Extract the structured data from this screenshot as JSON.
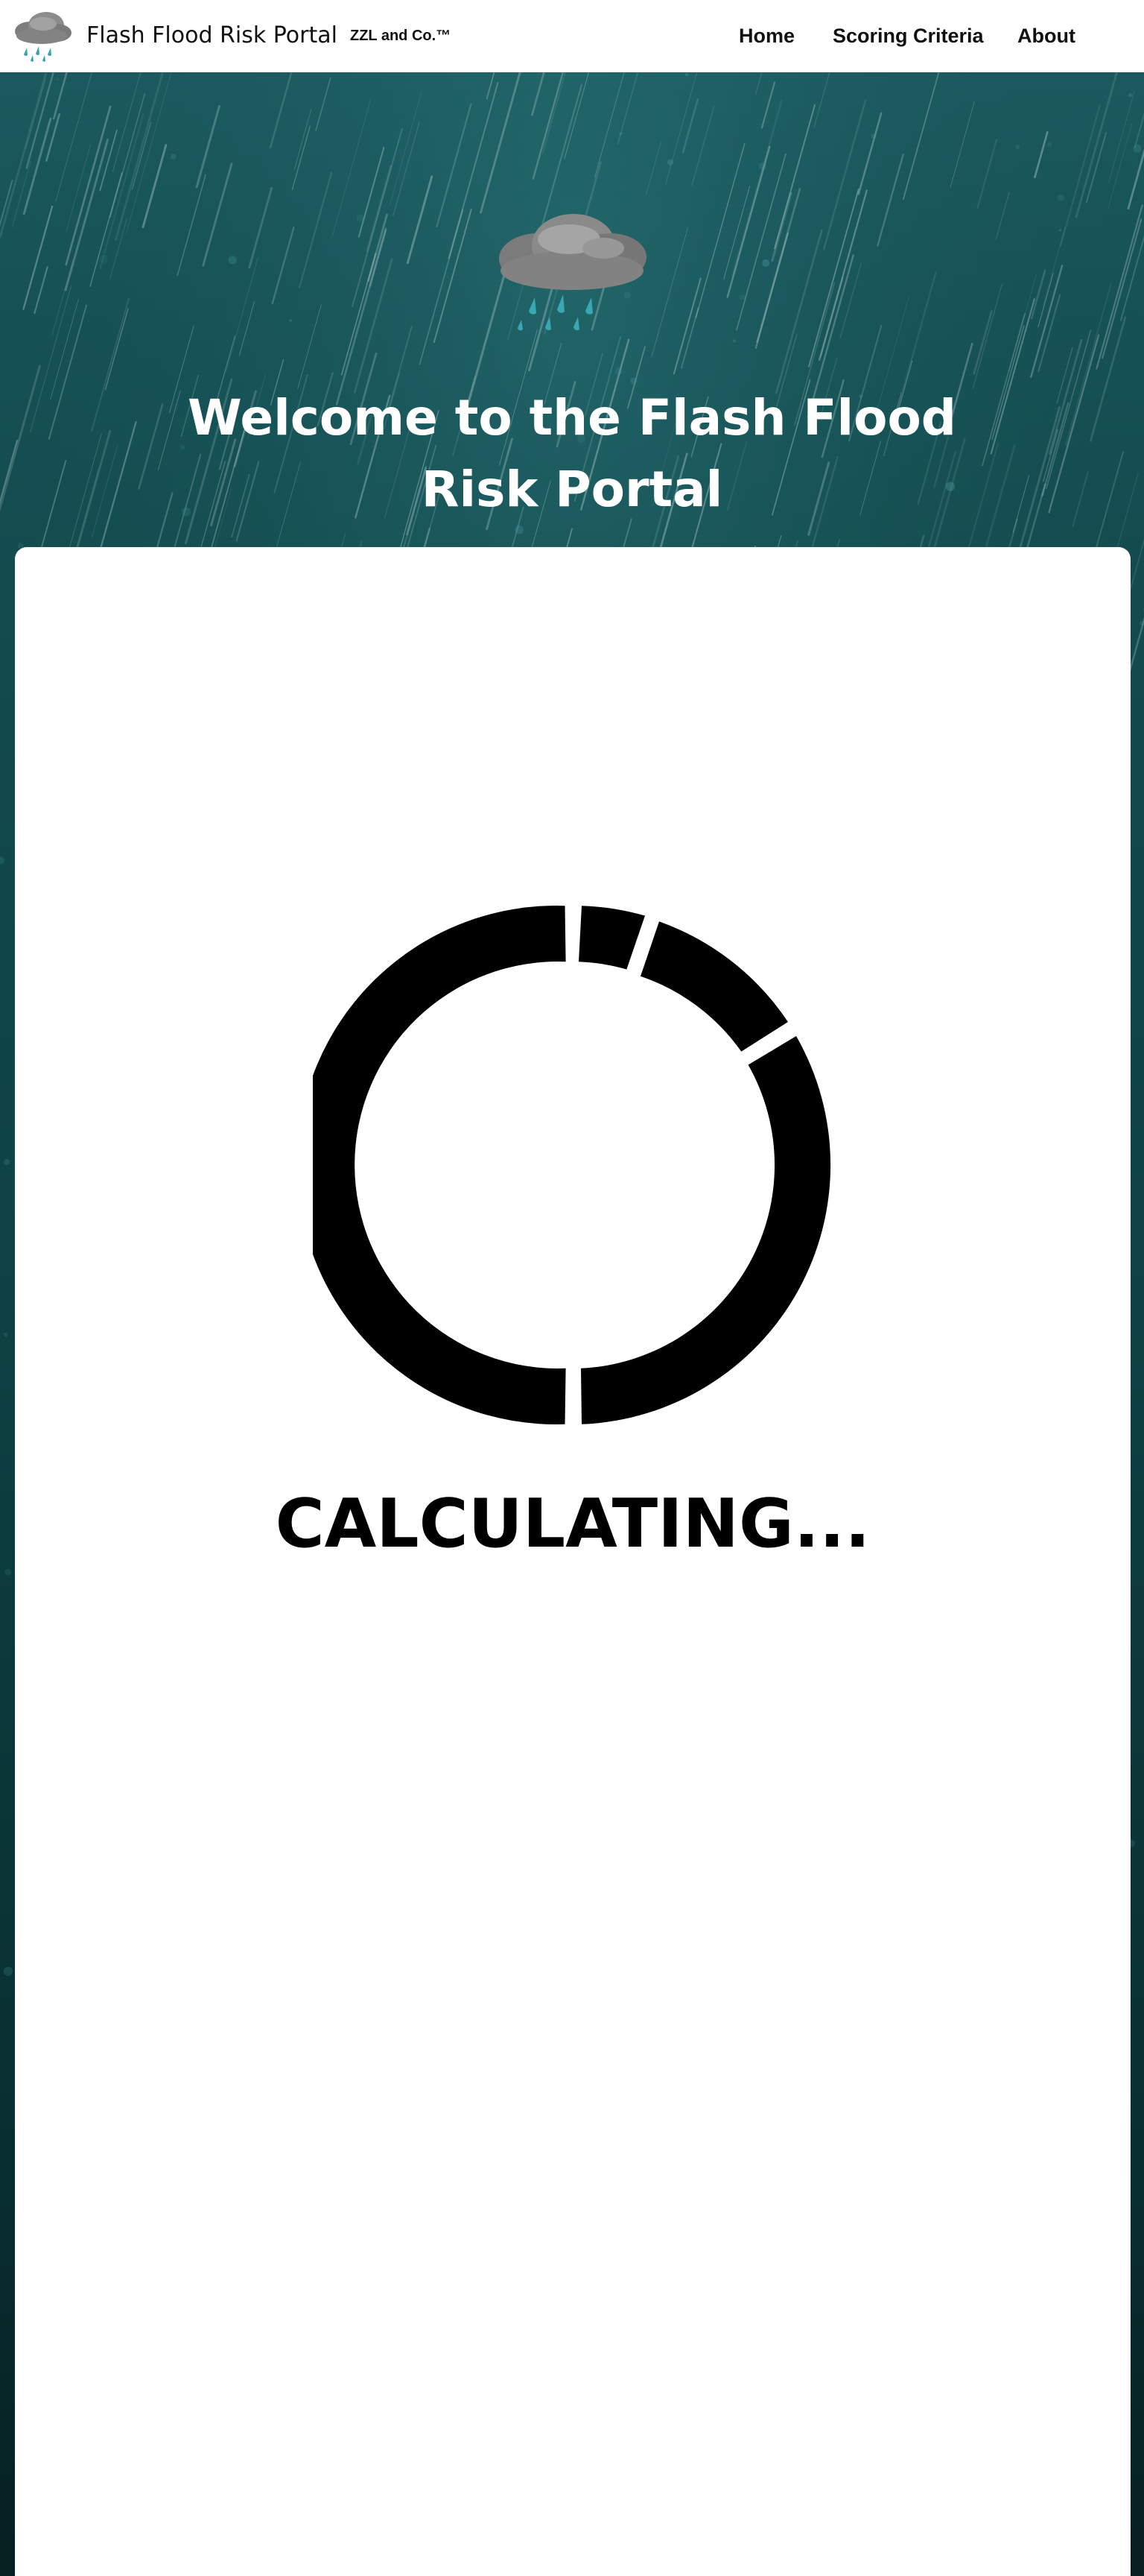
{
  "navbar": {
    "logo_icon": "rain-cloud-icon",
    "site_title": "Flash Flood Risk Portal",
    "company_tag": "ZZL and Co.™",
    "links": [
      {
        "label": "Home"
      },
      {
        "label": "Scoring Criteria"
      },
      {
        "label": "About"
      }
    ]
  },
  "hero": {
    "icon": "rain-cloud-icon",
    "heading": "Welcome to the Flash Flood Risk Portal",
    "background": "rain-photo"
  },
  "loading": {
    "icon": "loading-spinner-icon",
    "status_text": "CALCULATING..."
  },
  "colors": {
    "hero_teal": "#165256",
    "nav_background": "#ffffff",
    "card_background": "#ffffff",
    "text_dark": "#111111",
    "spinner": "#000000"
  }
}
